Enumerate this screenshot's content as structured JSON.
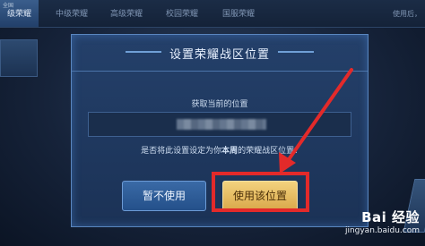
{
  "top_tabs": [
    "级荣耀",
    "中级荣耀",
    "高级荣耀",
    "校园荣耀",
    "国服荣耀"
  ],
  "corner_label": "全国",
  "top_right_text": "使用后，",
  "dialog": {
    "title": "设置荣耀战区位置",
    "location_label": "获取当前的位置",
    "question_prefix": "是否将此设置设定为你",
    "question_emph": "本周",
    "question_suffix": "的荣耀战区位置?",
    "cancel_label": "暂不使用",
    "confirm_label": "使用该位置"
  },
  "watermark": {
    "logo": "Bai 经验",
    "url": "jingyan.baidu.com"
  },
  "colors": {
    "highlight": "#e32a2a",
    "confirm_button": "#f3d27e",
    "cancel_button": "#3a6aa6"
  }
}
